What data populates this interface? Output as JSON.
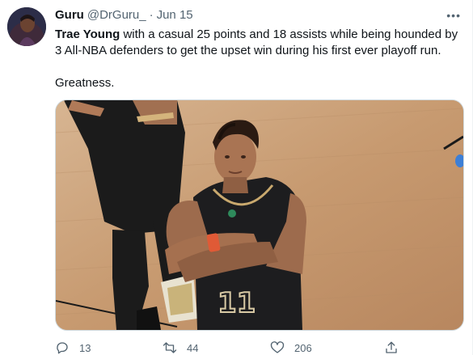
{
  "tweet": {
    "author_name": "Guru",
    "author_handle": "@DrGuru_",
    "separator": "·",
    "date": "Jun 15",
    "text_bold": "Trae Young",
    "text_rest": " with a casual 25 points and 18 assists while being hounded by 3 All-NBA defenders to get the upset win during his first ever playoff run.",
    "text_second": "Greatness.",
    "more_label": "•••"
  },
  "actions": {
    "replies": "13",
    "retweets": "44",
    "likes": "206"
  },
  "image": {
    "jersey_number": "11"
  },
  "icons": {
    "reply": "reply-icon",
    "retweet": "retweet-icon",
    "like": "heart-icon",
    "share": "share-icon",
    "more": "more-icon"
  },
  "colors": {
    "text_primary": "#0f1419",
    "text_secondary": "#536471",
    "border": "#cfd9de"
  }
}
